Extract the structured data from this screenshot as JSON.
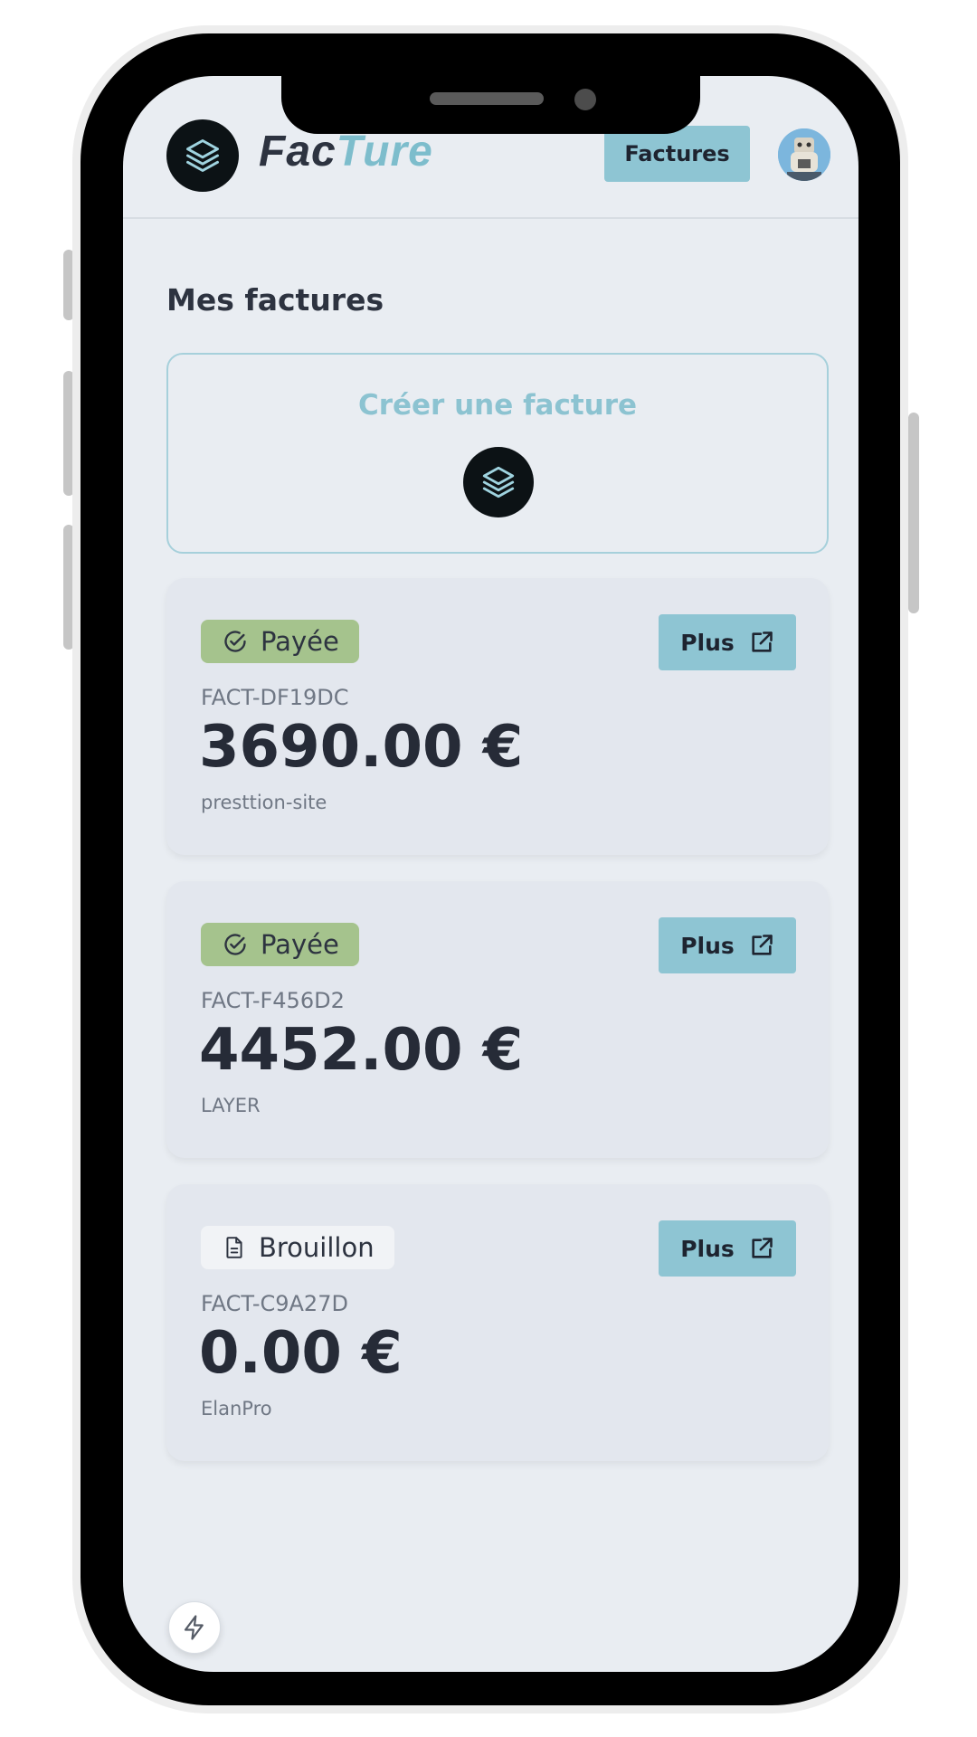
{
  "header": {
    "brand_part1": "Fac",
    "brand_part2": "Ture",
    "nav_button": "Factures"
  },
  "page": {
    "title": "Mes factures",
    "create_label": "Créer une facture"
  },
  "invoices": [
    {
      "status": "Payée",
      "status_icon": "check-circle-icon",
      "ref": "FACT-DF19DC",
      "amount": "3690.00 €",
      "client": "presttion-site",
      "action": "Plus"
    },
    {
      "status": "Payée",
      "status_icon": "check-circle-icon",
      "ref": "FACT-F456D2",
      "amount": "4452.00 €",
      "client": "LAYER",
      "action": "Plus"
    },
    {
      "status": "Brouillon",
      "status_icon": "document-icon",
      "ref": "FACT-C9A27D",
      "amount": "0.00 €",
      "client": "ElanPro",
      "action": "Plus"
    }
  ],
  "colors": {
    "accent": "#8ec5d3",
    "paid_badge": "#a5c38d",
    "draft_badge": "#f1f3f6",
    "background": "#e9edf2",
    "card": "#e3e7ee",
    "text_dark": "#262b37"
  }
}
